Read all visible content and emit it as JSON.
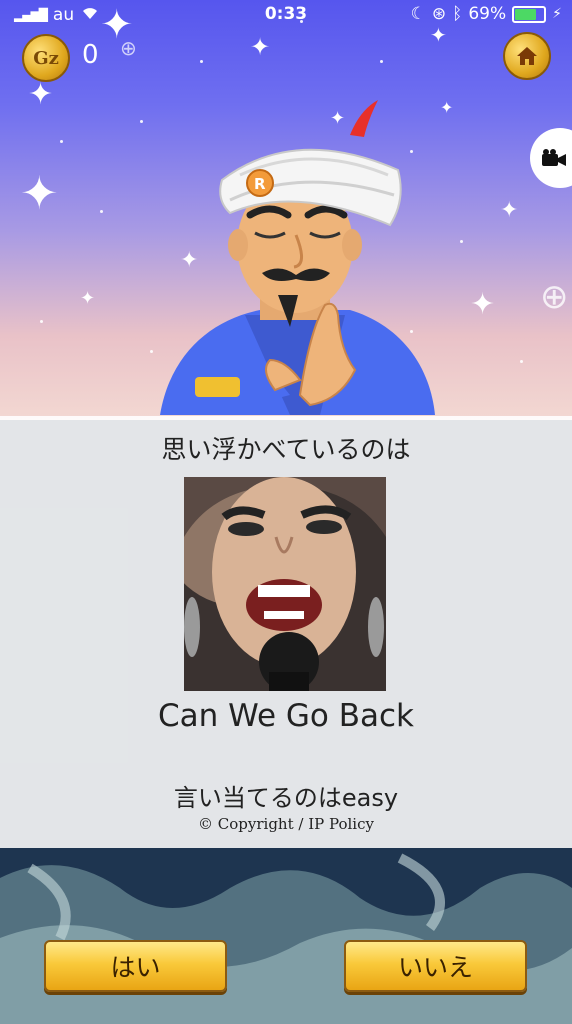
{
  "status_bar": {
    "carrier": "au",
    "time": "0:33",
    "battery": "69%"
  },
  "hud": {
    "coin_label": "Gz",
    "coin_count": "0"
  },
  "panel": {
    "title": "思い浮かべているのは",
    "answer": "Can We Go Back",
    "subtitle": "言い当てるのはeasy",
    "copyright": "© Copyright / IP Policy"
  },
  "buttons": {
    "yes": "はい",
    "no": "いいえ"
  },
  "icons": {
    "home": "home-icon",
    "camera": "video-camera-icon",
    "coin": "coin-icon"
  },
  "colors": {
    "sky_top": "#5656ee",
    "button_gold": "#f9c93a",
    "bottom_bg": "#1e3550"
  }
}
